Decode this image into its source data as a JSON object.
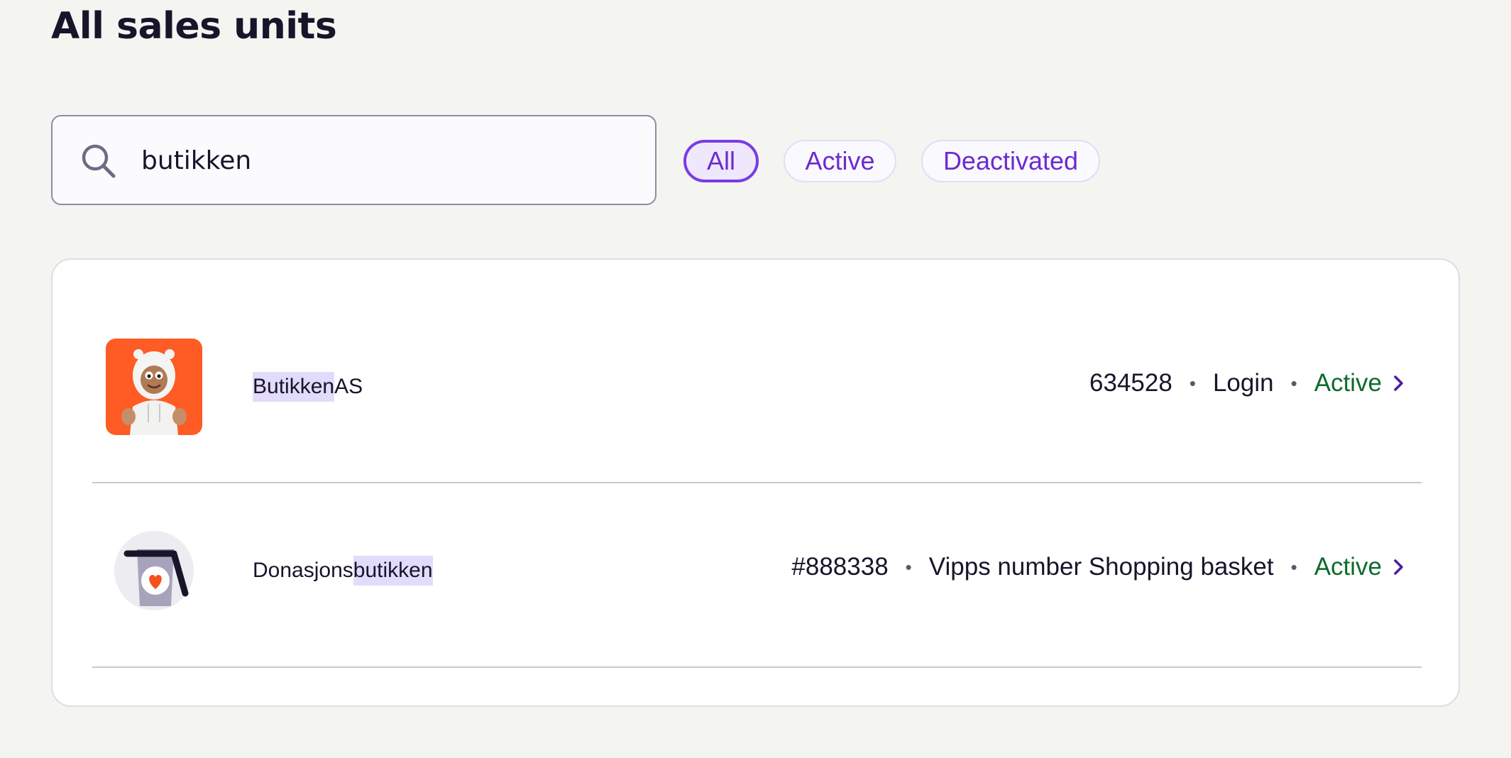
{
  "page": {
    "title": "All sales units"
  },
  "search": {
    "value": "butikken",
    "placeholder": ""
  },
  "filters": [
    {
      "label": "All",
      "selected": true
    },
    {
      "label": "Active",
      "selected": false
    },
    {
      "label": "Deactivated",
      "selected": false
    }
  ],
  "units": [
    {
      "name_highlight": "Butikken",
      "name_rest": " AS",
      "name_prefix": "",
      "number": "634528",
      "type": "Login",
      "status": "Active",
      "avatar": "bear-mascot-icon"
    },
    {
      "name_prefix": "Donasjons",
      "name_highlight": "butikken",
      "name_rest": "",
      "number": "#888338",
      "type": "Vipps number Shopping basket",
      "status": "Active",
      "avatar": "donation-box-icon"
    }
  ],
  "colors": {
    "accent": "#7a3be6",
    "status_active": "#0f6b2e",
    "highlight": "#e3dbfb",
    "avatar_orange": "#ff5b24"
  },
  "icons": {
    "search": "search-icon",
    "chevron": "chevron-right-icon"
  }
}
